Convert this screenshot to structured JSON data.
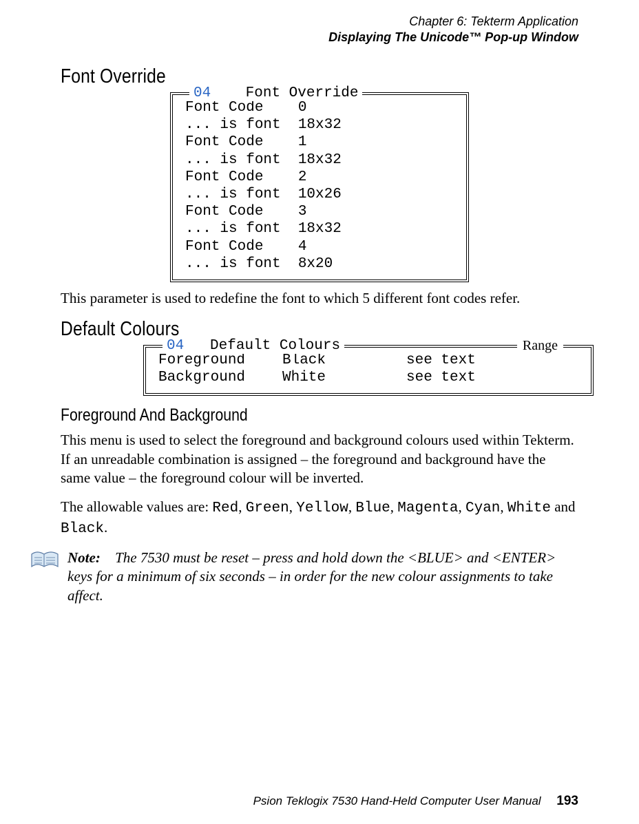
{
  "header": {
    "chapter_line": "Chapter 6: Tekterm Application",
    "section_line": "Displaying The Unicode™ Pop-up Window"
  },
  "font_override": {
    "heading": "Font Override",
    "box_num": "04",
    "box_title": "Font Override",
    "rows": [
      "Font Code    0",
      "... is font  18x32",
      "Font Code    1",
      "... is font  18x32",
      "Font Code    2",
      "... is font  10x26",
      "Font Code    3",
      "... is font  18x32",
      "Font Code    4",
      "... is font  8x20"
    ],
    "body": "This parameter is used to redefine the font to which 5 different font codes refer."
  },
  "default_colours": {
    "heading": "Default Colours",
    "box_num": "04",
    "box_title": "Default Colours",
    "range_label": "Range",
    "rows": [
      {
        "name": "Foreground",
        "value": "Black",
        "range": "see text"
      },
      {
        "name": "Background",
        "value": "White",
        "range": "see text"
      }
    ]
  },
  "fg_bg": {
    "heading": "Foreground And Background",
    "para1": "This menu is used to select the foreground and background colours used within Tekterm. If an unreadable combination is assigned – the foreground and background have the same value – the foreground colour will be inverted.",
    "para2_pre": "The allowable values are: ",
    "values": [
      "Red",
      "Green",
      "Yellow",
      "Blue",
      "Magenta",
      "Cyan",
      "White"
    ],
    "para2_join": ", ",
    "para2_and": " and ",
    "para2_last": "Black",
    "para2_end": "."
  },
  "note": {
    "label": "Note:",
    "text": "The 7530 must be reset – press and hold down the <BLUE> and <ENTER> keys for a minimum of six seconds – in order for the new colour assignments to take affect."
  },
  "footer": {
    "text": "Psion Teklogix 7530 Hand-Held Computer User Manual",
    "page": "193"
  }
}
